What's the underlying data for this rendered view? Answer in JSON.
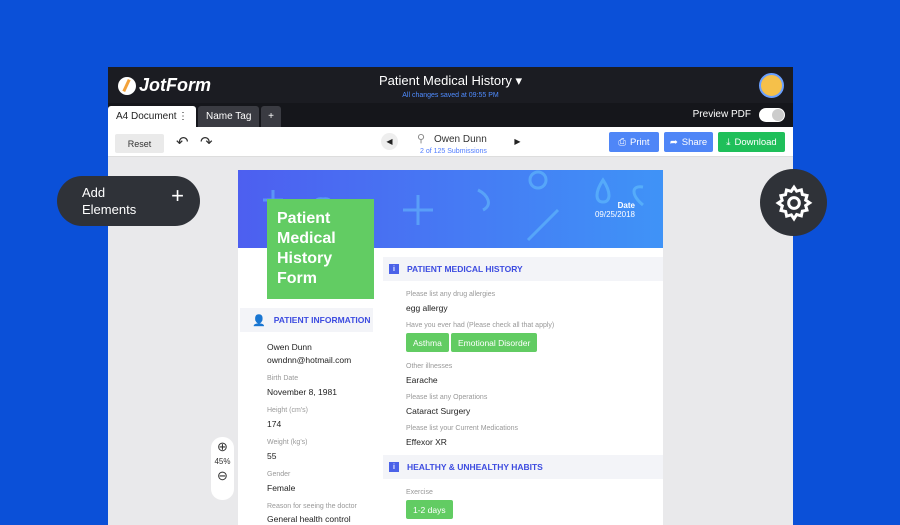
{
  "app": {
    "logo": "JotForm",
    "title": "Patient Medical History",
    "saved": "All changes saved at 09:55 PM"
  },
  "tabs": [
    {
      "label": "A4 Document"
    },
    {
      "label": "Name Tag"
    },
    {
      "label": "+"
    }
  ],
  "preview_pdf": "Preview PDF",
  "toolbar": {
    "reset": "Reset",
    "submission_name": "Owen Dunn",
    "submission_count": "2 of 125 Submissions",
    "print": "Print",
    "share": "Share",
    "download": "Download"
  },
  "colors": {
    "background": "#0b50d8",
    "print": "#4f86f7",
    "share": "#4f86f7",
    "download": "#1fbf5a",
    "green": "#62cc63",
    "accent": "#3d4ce0"
  },
  "floating": {
    "add_elements_line1": "Add",
    "add_elements_line2": "Elements",
    "zoom": "45%"
  },
  "form": {
    "title": [
      "Patient",
      "Medical",
      "History",
      "Form"
    ],
    "date_label": "Date",
    "date_value": "09/25/2018",
    "patient_info": {
      "header": "PATIENT INFORMATION",
      "name": "Owen Dunn",
      "email": "owndnn@hotmail.com",
      "fields": [
        {
          "label": "Birth Date",
          "value": "November 8, 1981"
        },
        {
          "label": "Height (cm's)",
          "value": "174"
        },
        {
          "label": "Weight (kg's)",
          "value": "55"
        },
        {
          "label": "Gender",
          "value": "Female"
        },
        {
          "label": "Reason for seeing the doctor",
          "value": "General health control"
        }
      ]
    },
    "medical_history": {
      "header": "PATIENT MEDICAL HISTORY",
      "allergies_label": "Please list any drug allergies",
      "allergies": "egg allergy",
      "had_label": "Have you ever had (Please check all that apply)",
      "had": [
        "Asthma",
        "Emotional Disorder"
      ],
      "fields": [
        {
          "label": "Other illnesses",
          "value": "Earache"
        },
        {
          "label": "Please list any Operations",
          "value": "Cataract Surgery"
        },
        {
          "label": "Please list your Current Medications",
          "value": "Effexor XR"
        }
      ]
    },
    "habits": {
      "header": "HEALTHY & UNHEALTHY HABITS",
      "exercise_label": "Exercise",
      "exercise": "1-2 days"
    }
  }
}
